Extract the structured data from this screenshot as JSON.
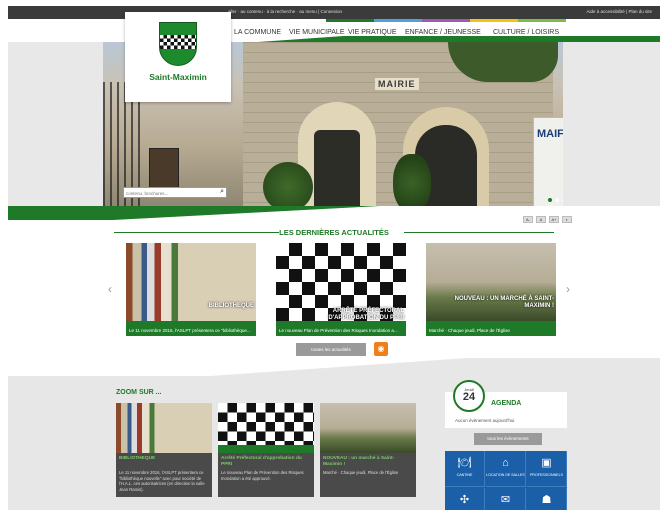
{
  "topbar": {
    "links": "aller · au contenu · à la recherche · au menu | Connexion",
    "links_right": "Aide à accessibilité | Plan du site"
  },
  "colors": {
    "brand_green": "#1e7a28",
    "strip": [
      "#1e7a28",
      "#4aa3df",
      "#9b59b6",
      "#f1c40f",
      "#7dbb42"
    ]
  },
  "nav": {
    "items": [
      "LA COMMUNE",
      "VIE MUNICIPALE",
      "VIE PRATIQUE",
      "ENFANCE / JEUNESSE",
      "CULTURE / LOISIRS"
    ]
  },
  "logo": {
    "name": "Saint-Maximin"
  },
  "hero": {
    "sign": "MAIRIE",
    "panel": "MAIF"
  },
  "search": {
    "placeholder": "contenu, brochures..."
  },
  "a11y": [
    "A-",
    "A",
    "A+",
    "◐"
  ],
  "news": {
    "title": "LES DERNIÈRES ACTUALITÉS",
    "cards": [
      {
        "caption": "BIBLIOTHEQUE",
        "desc": "Le 11 novembre 2016, l'ASLPT présentera ce \"bibliothèque..."
      },
      {
        "caption": "ARRÊTÉ PRÉFECTORAL D'APPROBATION DU PPRI",
        "desc": "Le nouveau Plan de Prévention des Risques Inondation a..."
      },
      {
        "caption": "NOUVEAU : UN MARCHÉ À SAINT-MAXIMIN !",
        "desc": "Marché · Chaque jeudi, Place de l'Église"
      }
    ],
    "all_label": "toutes les actualités",
    "rss_icon": "rss-icon"
  },
  "zoom": {
    "title": "ZOOM SUR ...",
    "cards": [
      {
        "title": "BIBLIOTHEQUE",
        "desc": "Le 11 novembre 2016, l'ASLPT présentera ce \"bibliothèque nouvelle\" avec pour société de l'H.A.L. ces autorisatrices (en direction la salle Jean Ramis)."
      },
      {
        "title": "Arrêté Préfectoral d'approbation du PPRI",
        "desc": "Le nouveau Plan de Prévention des Risques Inondation a été approuvé."
      },
      {
        "title": "NOUVEAU : un marché à Saint-Maximin !",
        "desc": "Marché · Chaque jeudi, Place de l'Église"
      }
    ]
  },
  "agenda": {
    "day_label": "Jeudi",
    "day_number": "24",
    "title": "AGENDA",
    "empty": "Aucun évènement aujourd'hui",
    "all_label": "tous les évènements"
  },
  "tiles": [
    {
      "label": "CANTINE",
      "icon": "plate-icon",
      "glyph": "🍽"
    },
    {
      "label": "LOCATION DE SALLES",
      "icon": "building-icon",
      "glyph": "⌂"
    },
    {
      "label": "PROFESSIONNELS",
      "icon": "bag-icon",
      "glyph": "▣"
    },
    {
      "label": "",
      "icon": "puzzle-icon",
      "glyph": "✣"
    },
    {
      "label": "",
      "icon": "mail-icon",
      "glyph": "✉"
    },
    {
      "label": "",
      "icon": "user-icon",
      "glyph": "☗"
    }
  ]
}
